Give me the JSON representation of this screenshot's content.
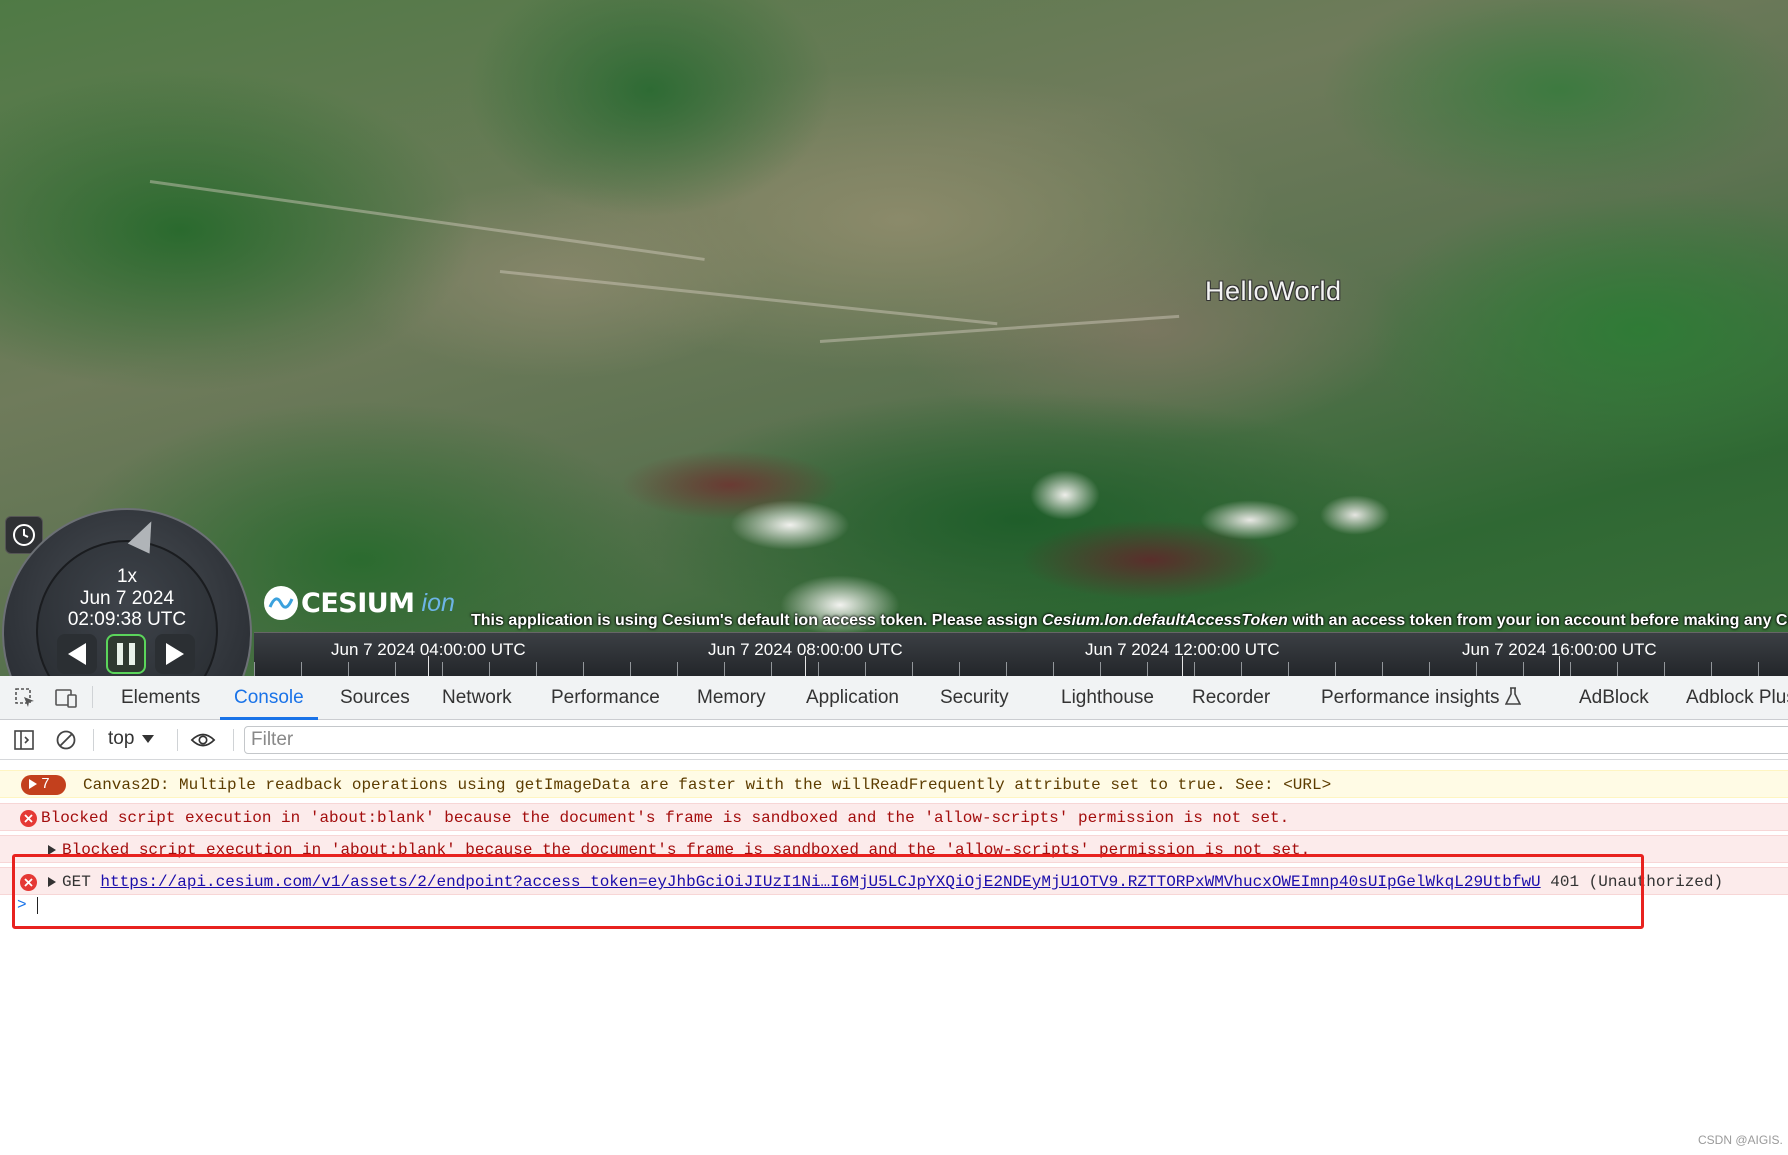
{
  "viewer": {
    "label": "HelloWorld",
    "animation": {
      "speed": "1x",
      "date": "Jun 7 2024",
      "time": "02:09:38 UTC",
      "state": "paused"
    },
    "logo": {
      "brand": "CESIUM",
      "suffix": "ion"
    },
    "credit": {
      "prefix": "This application is using Cesium's default ion access token. Please assign ",
      "code": "Cesium.Ion.defaultAccessToken",
      "suffix": " with an access token from your ion account before making any Cesium API calls."
    },
    "timeline": {
      "labels": [
        "Jun 7 2024 04:00:00 UTC",
        "Jun 7 2024 08:00:00 UTC",
        "Jun 7 2024 12:00:00 UTC",
        "Jun 7 2024 16:00:00 UTC"
      ]
    }
  },
  "devtools": {
    "tabs": [
      "Elements",
      "Console",
      "Sources",
      "Network",
      "Performance",
      "Memory",
      "Application",
      "Security",
      "Lighthouse",
      "Recorder",
      "Performance insights",
      "AdBlock",
      "Adblock Plus"
    ],
    "active_tab": "Console",
    "toolbar": {
      "context": "top",
      "filter_placeholder": "Filter"
    },
    "console": {
      "messages": [
        {
          "level": "warning",
          "count": "7",
          "text": "Canvas2D: Multiple readback operations using getImageData are faster with the willReadFrequently attribute set to true. See: <URL>"
        },
        {
          "level": "error",
          "text": "Blocked script execution in 'about:blank' because the document's frame is sandboxed and the 'allow-scripts' permission is not set."
        },
        {
          "level": "error",
          "text": "Blocked script execution in 'about:blank' because the document's frame is sandboxed and the 'allow-scripts' permission is not set."
        },
        {
          "level": "error",
          "method": "GET",
          "url": "https://api.cesium.com/v1/assets/2/endpoint?access_token=eyJhbGciOiJIUzI1Ni…I6MjU5LCJpYXQiOjE2NDEyMjU1OTV9.RZTTORPxWMVhucxOWEImnp40sUIpGelWkqL29UtbfwU",
          "status": "401 (Unauthorized)"
        }
      ],
      "prompt_symbol": ">"
    }
  },
  "watermark": "CSDN @AIGIS.",
  "colors": {
    "accent": "#1a73e8",
    "error": "#e53935",
    "warning_badge": "#c3401d",
    "highlight": "#e8221f"
  }
}
